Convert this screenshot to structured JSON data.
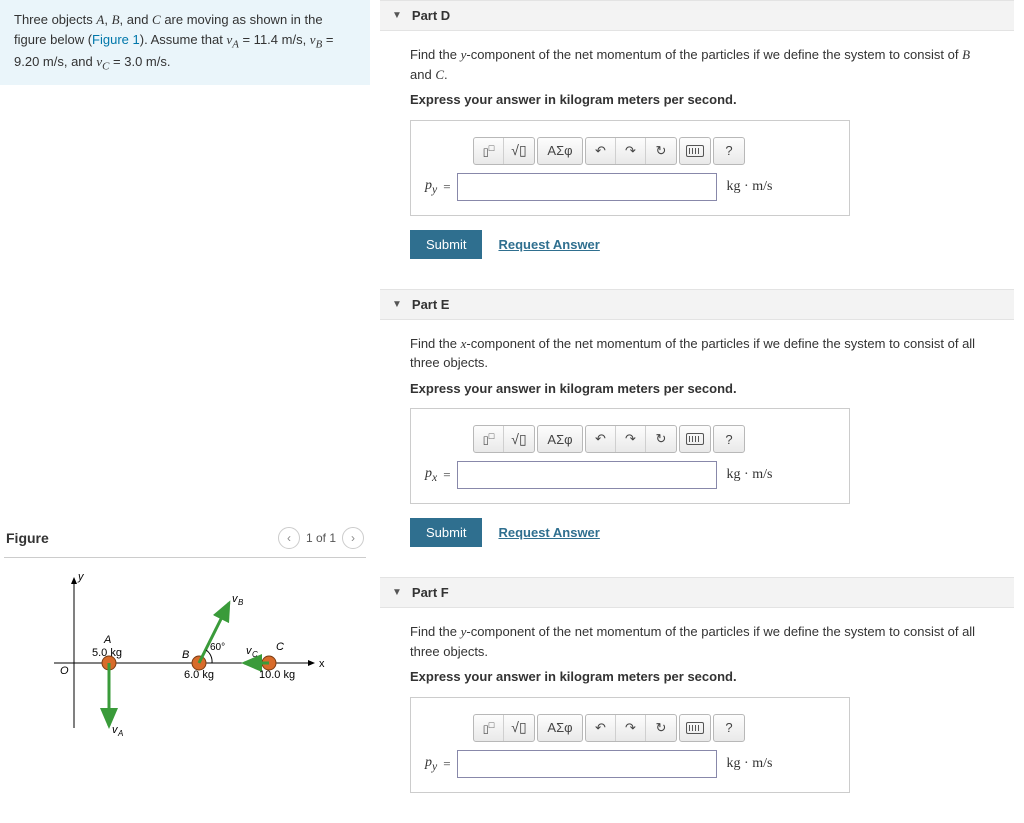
{
  "problem": {
    "intro_a": "Three objects ",
    "intro_b": ", and ",
    "intro_c": " are moving as shown in the figure below (",
    "figref": "Figure 1",
    "intro_d": "). Assume that ",
    "va_sym": "v",
    "va_sub": "A",
    "va_val": " = 11.4 m/s, ",
    "vb_sym": "v",
    "vb_sub": "B",
    "vb_val": " = 9.20 m/s, and ",
    "vc_sym": "v",
    "vc_sub": "C",
    "vc_val": " = 3.0 m/s.",
    "A": "A",
    "B": "B",
    "C": "C"
  },
  "figure": {
    "title": "Figure",
    "counter": "1 of 1",
    "labels": {
      "A": "A",
      "B": "B",
      "C": "C",
      "massA": "5.0 kg",
      "massB": "6.0 kg",
      "massC": "10.0 kg",
      "angle": "60°",
      "vA": "vA",
      "vB": "vB",
      "vC": "vC",
      "x": "x",
      "y": "y",
      "O": "O"
    }
  },
  "parts": {
    "D": {
      "title": "Part D",
      "instr_a": "Find the ",
      "instr_comp": "y",
      "instr_b": "-component of the net momentum of the particles if we define the system to consist of ",
      "instr_c": " and ",
      "instr_d": ".",
      "obj1": "B",
      "obj2": "C",
      "express": "Express your answer in kilogram meters per second.",
      "var_html": "p",
      "var_sub": "y",
      "unit": "kg · m/s"
    },
    "E": {
      "title": "Part E",
      "instr_a": "Find the ",
      "instr_comp": "x",
      "instr_b": "-component of the net momentum of the particles if we define the system to consist of all three objects.",
      "express": "Express your answer in kilogram meters per second.",
      "var_html": "p",
      "var_sub": "x",
      "unit": "kg · m/s"
    },
    "F": {
      "title": "Part F",
      "instr_a": "Find the ",
      "instr_comp": "y",
      "instr_b": "-component of the net momentum of the particles if we define the system to consist of all three objects.",
      "express": "Express your answer in kilogram meters per second.",
      "var_html": "p",
      "var_sub": "y",
      "unit": "kg · m/s"
    }
  },
  "toolbar": {
    "template": "▯√▯",
    "greek": "ΑΣφ",
    "undo": "↶",
    "redo": "↷",
    "reset": "↻",
    "help": "?"
  },
  "buttons": {
    "submit": "Submit",
    "request": "Request Answer"
  },
  "nav": {
    "prev": "‹",
    "next": "›"
  }
}
